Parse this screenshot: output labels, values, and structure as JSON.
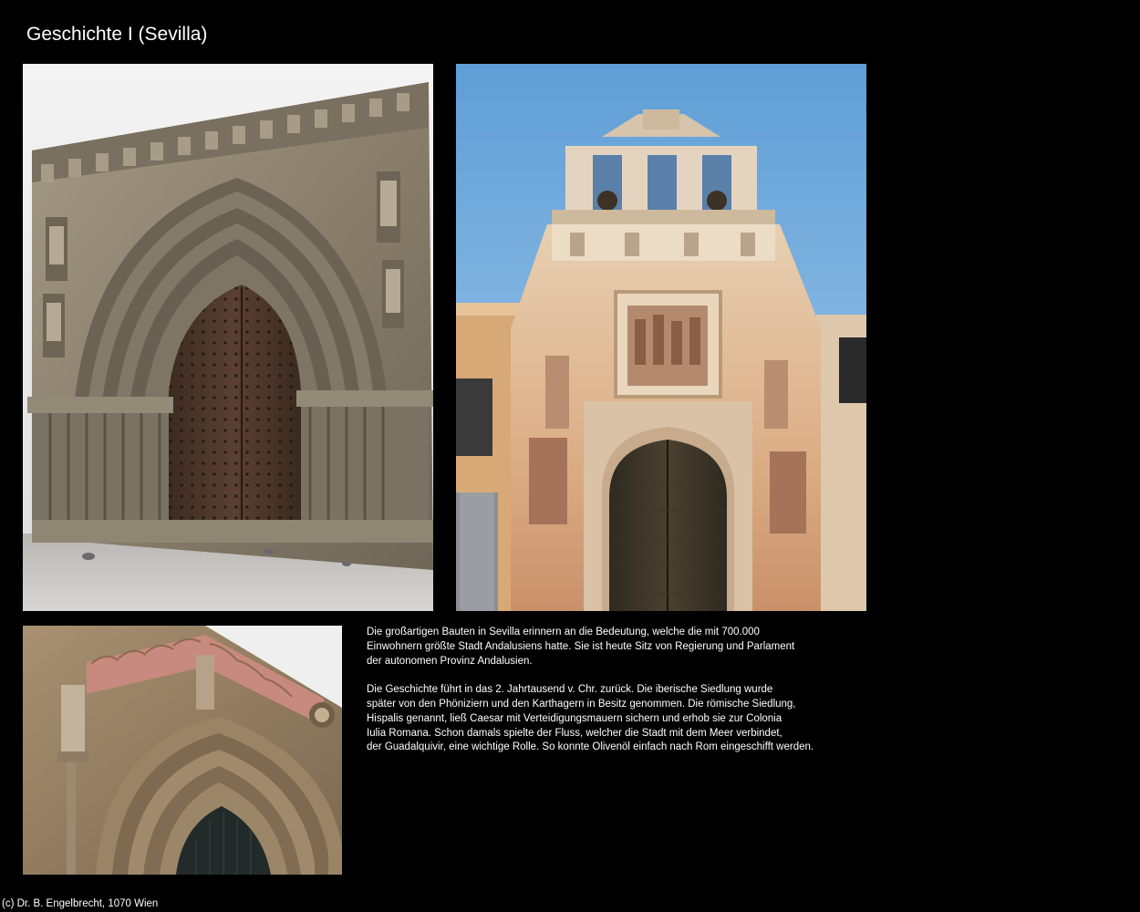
{
  "page": {
    "title": "Geschichte I (Sevilla)",
    "footer": "(c) Dr. B. Engelbrecht, 1070 Wien"
  },
  "photos": [
    {
      "name": "gothic-portal-photo",
      "subject": "Gothic church portal with pointed arch and wooden door"
    },
    {
      "name": "cathedral-bell-gable-photo",
      "subject": "Baroque bell gable above horseshoe-arch door with statues and relief"
    },
    {
      "name": "gothic-arch-detail-photo",
      "subject": "Detail of Gothic arch portal with statues"
    }
  ],
  "text": {
    "paragraph1": [
      "Die großartigen Bauten in Sevilla erinnern an die Bedeutung, welche die mit 700.000",
      "Einwohnern größte Stadt Andalusiens hatte. Sie ist heute Sitz von Regierung und Parlament",
      "der autonomen Provinz Andalusien."
    ],
    "paragraph2": [
      "Die Geschichte führt in das 2. Jahrtausend v. Chr. zurück. Die iberische Siedlung wurde",
      "später von den Phöniziern und den Karthagern in Besitz genommen. Die römische Siedlung,",
      "Hispalis genannt, ließ Caesar mit Verteidigungsmauern sichern und erhob sie zur Colonia",
      "Iulia Romana. Schon damals spielte der Fluss, welcher die Stadt mit dem Meer verbindet,",
      "der Guadalquivir, eine wichtige Rolle. So konnte Olivenöl einfach nach Rom eingeschifft werden."
    ]
  },
  "colors": {
    "background": "#000000",
    "text": "#ffffff",
    "sky": "#6fa8d8",
    "stone": "#8a8070",
    "ochre": "#d7a070"
  }
}
